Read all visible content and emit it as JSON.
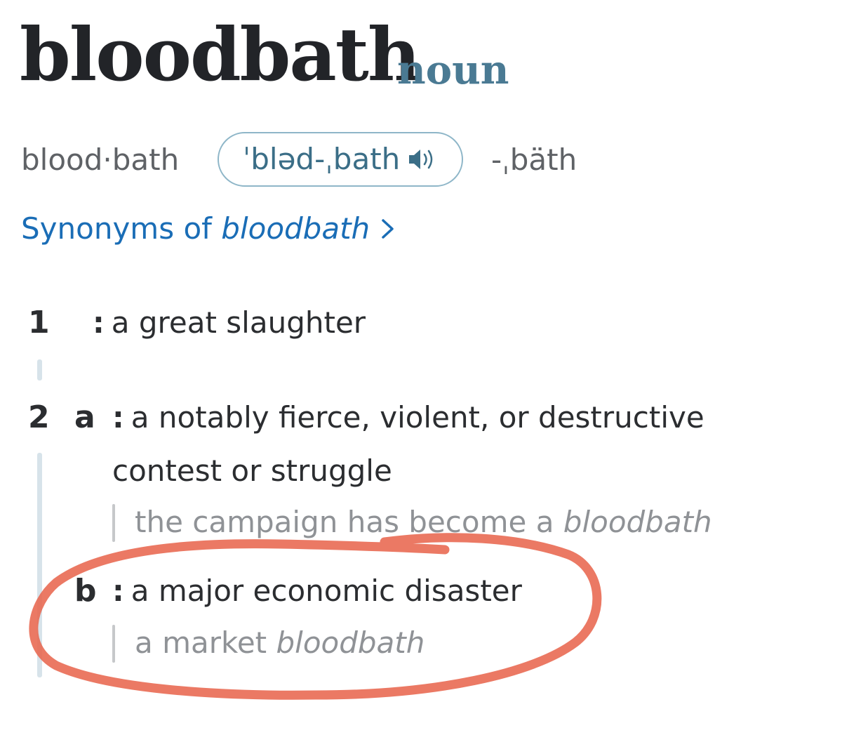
{
  "entry": {
    "headword": "bloodbath",
    "part_of_speech": "noun",
    "syllables": "blood·bath",
    "pronunciation": "ˈbləd-ˌbath",
    "pronunciation_alt": "-ˌbäth",
    "speaker_icon": "speaker-icon",
    "synonyms_link": {
      "prefix": "Synonyms of ",
      "word": "bloodbath",
      "icon": "chevron-right-icon"
    }
  },
  "senses": [
    {
      "number": "1",
      "definition": "a great slaughter"
    },
    {
      "number": "2",
      "subsenses": [
        {
          "letter": "a",
          "definition": "a notably fierce, violent, or destructive contest or struggle",
          "example_prefix": "the campaign has become a ",
          "example_word": "bloodbath"
        },
        {
          "letter": "b",
          "definition": "a major economic disaster",
          "example_prefix": "a market ",
          "example_word": "bloodbath"
        }
      ]
    }
  ],
  "colors": {
    "headword": "#222428",
    "part_of_speech": "#4a7a93",
    "link": "#1a6db6",
    "example": "#8f9296",
    "annotation": "#e8674f"
  },
  "annotation": {
    "type": "hand-drawn circle",
    "highlights": "sense 2 b"
  }
}
